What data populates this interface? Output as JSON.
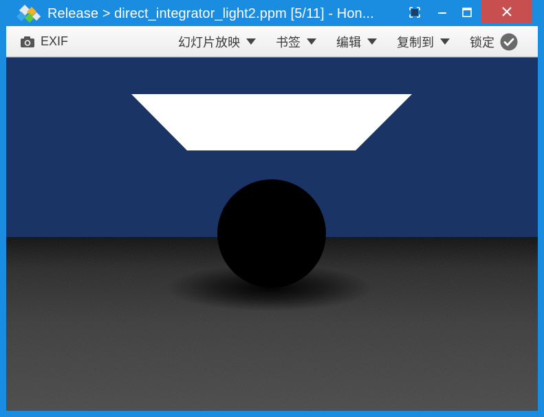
{
  "window": {
    "title": "Release > direct_integrator_light2.ppm [5/11] - Hon...",
    "accent_color": "#1b8de0",
    "close_color": "#c74f4f",
    "buttons": [
      "compact-view-icon",
      "minimize-icon",
      "maximize-icon",
      "close-icon"
    ]
  },
  "toolbar": {
    "exif_label": "EXIF",
    "slideshow_label": "幻灯片放映",
    "bookmarks_label": "书签",
    "edit_label": "编辑",
    "copyto_label": "复制到",
    "lock_label": "锁定"
  },
  "image": {
    "icons": [
      "camera-icon",
      "dropdown-caret-icon",
      "check-circle-icon"
    ],
    "wall_color": "#1a3466",
    "light_color": "#ffffff",
    "sphere_color": "#000000",
    "floor_color": "#3a3a3a"
  }
}
